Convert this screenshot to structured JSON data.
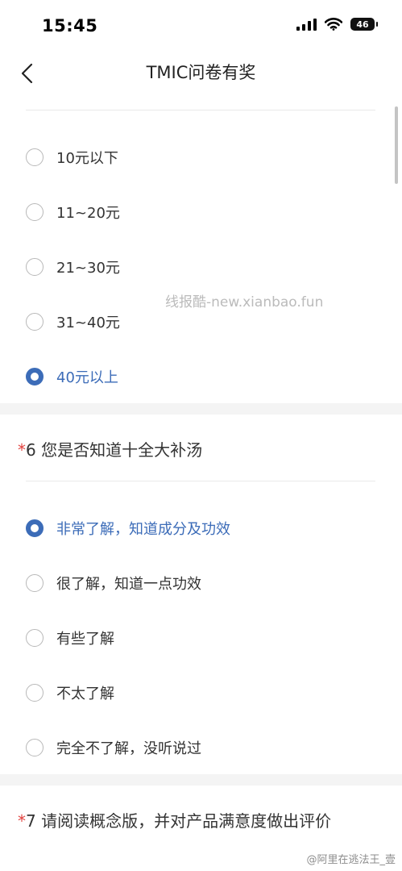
{
  "status_bar": {
    "time": "15:45",
    "battery": "46"
  },
  "header": {
    "title": "TMIC问卷有奖",
    "back_icon": "chevron-left-icon"
  },
  "question5": {
    "options": [
      {
        "label": "10元以下",
        "selected": false
      },
      {
        "label": "11~20元",
        "selected": false
      },
      {
        "label": "21~30元",
        "selected": false
      },
      {
        "label": "31~40元",
        "selected": false
      },
      {
        "label": "40元以上",
        "selected": true
      }
    ]
  },
  "question6": {
    "required_mark": "*",
    "title": "6 您是否知道十全大补汤",
    "options": [
      {
        "label": "非常了解，知道成分及功效",
        "selected": true
      },
      {
        "label": "很了解，知道一点功效",
        "selected": false
      },
      {
        "label": "有些了解",
        "selected": false
      },
      {
        "label": "不太了解",
        "selected": false
      },
      {
        "label": "完全不了解，没听说过",
        "selected": false
      }
    ]
  },
  "question7": {
    "required_mark": "*",
    "title": "7 请阅读概念版，并对产品满意度做出评价"
  },
  "watermarks": {
    "site": "线报酷-new.xianbao.fun",
    "weibo": "@阿里在逃法王_壹"
  },
  "colors": {
    "accent": "#3c6cb8",
    "required": "#e2423e",
    "background": "#f4f4f4"
  }
}
